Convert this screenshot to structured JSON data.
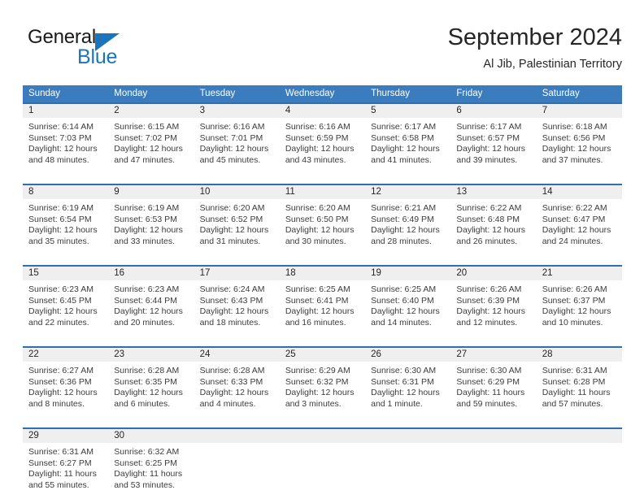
{
  "branding": {
    "logo_primary": "General",
    "logo_secondary": "Blue",
    "accent_color": "#1b75bb"
  },
  "header": {
    "title": "September 2024",
    "subtitle": "Al Jib, Palestinian Territory"
  },
  "calendar": {
    "header_bg": "#3a7cbe",
    "row_line_color": "#2f6fb0",
    "daynum_bg": "#efefef",
    "weekday_headers": [
      "Sunday",
      "Monday",
      "Tuesday",
      "Wednesday",
      "Thursday",
      "Friday",
      "Saturday"
    ],
    "weeks": [
      [
        {
          "day": "1",
          "sunrise": "Sunrise: 6:14 AM",
          "sunset": "Sunset: 7:03 PM",
          "daylight1": "Daylight: 12 hours",
          "daylight2": "and 48 minutes."
        },
        {
          "day": "2",
          "sunrise": "Sunrise: 6:15 AM",
          "sunset": "Sunset: 7:02 PM",
          "daylight1": "Daylight: 12 hours",
          "daylight2": "and 47 minutes."
        },
        {
          "day": "3",
          "sunrise": "Sunrise: 6:16 AM",
          "sunset": "Sunset: 7:01 PM",
          "daylight1": "Daylight: 12 hours",
          "daylight2": "and 45 minutes."
        },
        {
          "day": "4",
          "sunrise": "Sunrise: 6:16 AM",
          "sunset": "Sunset: 6:59 PM",
          "daylight1": "Daylight: 12 hours",
          "daylight2": "and 43 minutes."
        },
        {
          "day": "5",
          "sunrise": "Sunrise: 6:17 AM",
          "sunset": "Sunset: 6:58 PM",
          "daylight1": "Daylight: 12 hours",
          "daylight2": "and 41 minutes."
        },
        {
          "day": "6",
          "sunrise": "Sunrise: 6:17 AM",
          "sunset": "Sunset: 6:57 PM",
          "daylight1": "Daylight: 12 hours",
          "daylight2": "and 39 minutes."
        },
        {
          "day": "7",
          "sunrise": "Sunrise: 6:18 AM",
          "sunset": "Sunset: 6:56 PM",
          "daylight1": "Daylight: 12 hours",
          "daylight2": "and 37 minutes."
        }
      ],
      [
        {
          "day": "8",
          "sunrise": "Sunrise: 6:19 AM",
          "sunset": "Sunset: 6:54 PM",
          "daylight1": "Daylight: 12 hours",
          "daylight2": "and 35 minutes."
        },
        {
          "day": "9",
          "sunrise": "Sunrise: 6:19 AM",
          "sunset": "Sunset: 6:53 PM",
          "daylight1": "Daylight: 12 hours",
          "daylight2": "and 33 minutes."
        },
        {
          "day": "10",
          "sunrise": "Sunrise: 6:20 AM",
          "sunset": "Sunset: 6:52 PM",
          "daylight1": "Daylight: 12 hours",
          "daylight2": "and 31 minutes."
        },
        {
          "day": "11",
          "sunrise": "Sunrise: 6:20 AM",
          "sunset": "Sunset: 6:50 PM",
          "daylight1": "Daylight: 12 hours",
          "daylight2": "and 30 minutes."
        },
        {
          "day": "12",
          "sunrise": "Sunrise: 6:21 AM",
          "sunset": "Sunset: 6:49 PM",
          "daylight1": "Daylight: 12 hours",
          "daylight2": "and 28 minutes."
        },
        {
          "day": "13",
          "sunrise": "Sunrise: 6:22 AM",
          "sunset": "Sunset: 6:48 PM",
          "daylight1": "Daylight: 12 hours",
          "daylight2": "and 26 minutes."
        },
        {
          "day": "14",
          "sunrise": "Sunrise: 6:22 AM",
          "sunset": "Sunset: 6:47 PM",
          "daylight1": "Daylight: 12 hours",
          "daylight2": "and 24 minutes."
        }
      ],
      [
        {
          "day": "15",
          "sunrise": "Sunrise: 6:23 AM",
          "sunset": "Sunset: 6:45 PM",
          "daylight1": "Daylight: 12 hours",
          "daylight2": "and 22 minutes."
        },
        {
          "day": "16",
          "sunrise": "Sunrise: 6:23 AM",
          "sunset": "Sunset: 6:44 PM",
          "daylight1": "Daylight: 12 hours",
          "daylight2": "and 20 minutes."
        },
        {
          "day": "17",
          "sunrise": "Sunrise: 6:24 AM",
          "sunset": "Sunset: 6:43 PM",
          "daylight1": "Daylight: 12 hours",
          "daylight2": "and 18 minutes."
        },
        {
          "day": "18",
          "sunrise": "Sunrise: 6:25 AM",
          "sunset": "Sunset: 6:41 PM",
          "daylight1": "Daylight: 12 hours",
          "daylight2": "and 16 minutes."
        },
        {
          "day": "19",
          "sunrise": "Sunrise: 6:25 AM",
          "sunset": "Sunset: 6:40 PM",
          "daylight1": "Daylight: 12 hours",
          "daylight2": "and 14 minutes."
        },
        {
          "day": "20",
          "sunrise": "Sunrise: 6:26 AM",
          "sunset": "Sunset: 6:39 PM",
          "daylight1": "Daylight: 12 hours",
          "daylight2": "and 12 minutes."
        },
        {
          "day": "21",
          "sunrise": "Sunrise: 6:26 AM",
          "sunset": "Sunset: 6:37 PM",
          "daylight1": "Daylight: 12 hours",
          "daylight2": "and 10 minutes."
        }
      ],
      [
        {
          "day": "22",
          "sunrise": "Sunrise: 6:27 AM",
          "sunset": "Sunset: 6:36 PM",
          "daylight1": "Daylight: 12 hours",
          "daylight2": "and 8 minutes."
        },
        {
          "day": "23",
          "sunrise": "Sunrise: 6:28 AM",
          "sunset": "Sunset: 6:35 PM",
          "daylight1": "Daylight: 12 hours",
          "daylight2": "and 6 minutes."
        },
        {
          "day": "24",
          "sunrise": "Sunrise: 6:28 AM",
          "sunset": "Sunset: 6:33 PM",
          "daylight1": "Daylight: 12 hours",
          "daylight2": "and 4 minutes."
        },
        {
          "day": "25",
          "sunrise": "Sunrise: 6:29 AM",
          "sunset": "Sunset: 6:32 PM",
          "daylight1": "Daylight: 12 hours",
          "daylight2": "and 3 minutes."
        },
        {
          "day": "26",
          "sunrise": "Sunrise: 6:30 AM",
          "sunset": "Sunset: 6:31 PM",
          "daylight1": "Daylight: 12 hours",
          "daylight2": "and 1 minute."
        },
        {
          "day": "27",
          "sunrise": "Sunrise: 6:30 AM",
          "sunset": "Sunset: 6:29 PM",
          "daylight1": "Daylight: 11 hours",
          "daylight2": "and 59 minutes."
        },
        {
          "day": "28",
          "sunrise": "Sunrise: 6:31 AM",
          "sunset": "Sunset: 6:28 PM",
          "daylight1": "Daylight: 11 hours",
          "daylight2": "and 57 minutes."
        }
      ],
      [
        {
          "day": "29",
          "sunrise": "Sunrise: 6:31 AM",
          "sunset": "Sunset: 6:27 PM",
          "daylight1": "Daylight: 11 hours",
          "daylight2": "and 55 minutes."
        },
        {
          "day": "30",
          "sunrise": "Sunrise: 6:32 AM",
          "sunset": "Sunset: 6:25 PM",
          "daylight1": "Daylight: 11 hours",
          "daylight2": "and 53 minutes."
        },
        {
          "day": "",
          "sunrise": "",
          "sunset": "",
          "daylight1": "",
          "daylight2": ""
        },
        {
          "day": "",
          "sunrise": "",
          "sunset": "",
          "daylight1": "",
          "daylight2": ""
        },
        {
          "day": "",
          "sunrise": "",
          "sunset": "",
          "daylight1": "",
          "daylight2": ""
        },
        {
          "day": "",
          "sunrise": "",
          "sunset": "",
          "daylight1": "",
          "daylight2": ""
        },
        {
          "day": "",
          "sunrise": "",
          "sunset": "",
          "daylight1": "",
          "daylight2": ""
        }
      ]
    ]
  }
}
